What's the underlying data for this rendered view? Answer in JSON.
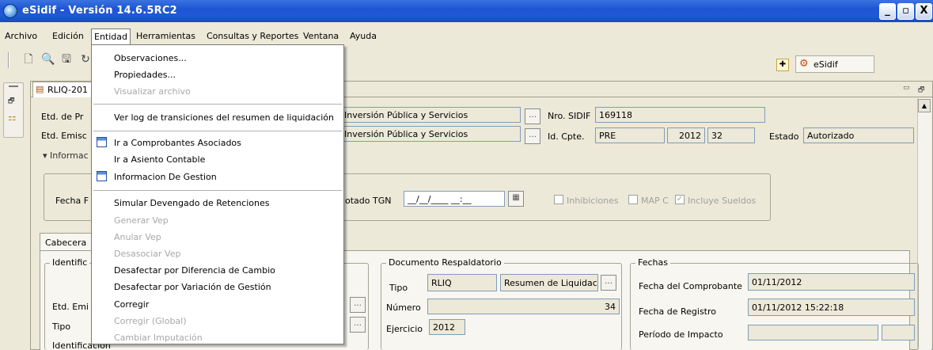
{
  "window": {
    "title": "eSidif - Versión 14.6.5RC2",
    "min": "_",
    "restore": "▫",
    "close": "X"
  },
  "menubar": [
    "Archivo",
    "Edición",
    "Entidad",
    "Herramientas",
    "Consultas y Reportes",
    "Ventana",
    "Ayuda"
  ],
  "toolbar": {
    "esidif": "eSidif"
  },
  "tab": {
    "label": "RLIQ-201"
  },
  "form": {
    "etd_pr_label": "Etd. de Pr",
    "etd_emis_label": "Etd. Emisc",
    "informac_label": "Informac",
    "inversion1": "Inversión Pública y Servicios",
    "inversion2": "Inversión Pública y Servicios",
    "nro_sidif_label": "Nro. SIDIF",
    "nro_sidif": "169118",
    "id_cpte_label": "Id. Cpte.",
    "id_cpte_tipo": "PRE",
    "id_cpte_anio": "2012",
    "id_cpte_num": "32",
    "estado_label": "Estado",
    "estado": "Autorizado",
    "fecha_label": "Fecha F",
    "otado_tgn": "otado TGN",
    "fecha_mask": "__/__/____ __:__",
    "inhibiciones": "Inhibiciones",
    "map_c": "MAP C",
    "incluye_sueldos": "Incluye Sueldos",
    "cabecera_tab": "Cabecera",
    "identific_label": "Identific",
    "etd_emi2_label": "Etd. Emi",
    "tipo2_label": "Tipo",
    "identificacion_label": "Identificación",
    "doc_resp_title": "Documento Respaldatorio",
    "doc_tipo_label": "Tipo",
    "doc_tipo": "RLIQ",
    "doc_tipo_desc": "Resumen de Liquidac",
    "doc_numero_label": "Número",
    "doc_numero": "34",
    "doc_ejercicio_label": "Ejercicio",
    "doc_ejercicio": "2012",
    "fechas_title": "Fechas",
    "fecha_cpte_label": "Fecha del Comprobante",
    "fecha_cpte": "01/11/2012",
    "fecha_reg_label": "Fecha de Registro",
    "fecha_reg": "01/11/2012 15:22:18",
    "periodo_label": "Período de Impacto"
  },
  "dropdown": {
    "observaciones": "Observaciones...",
    "propiedades": "Propiedades...",
    "visualizar": "Visualizar archivo",
    "ver_log": "Ver log de transiciones del resumen de liquidación",
    "ir_comp": "Ir a Comprobantes Asociados",
    "ir_asiento": "Ir a Asiento Contable",
    "info_gestion": "Informacion De Gestion",
    "simular": "Simular Devengado de Retenciones",
    "generar_vep": "Generar Vep",
    "anular_vep": "Anular Vep",
    "desasociar_vep": "Desasociar Vep",
    "desafectar_cambio": "Desafectar por Diferencia de Cambio",
    "desafectar_gestion": "Desafectar por Variación de Gestión",
    "corregir": "Corregir",
    "corregir_global": "Corregir (Global)",
    "cambiar_imput": "Cambiar Imputación"
  }
}
